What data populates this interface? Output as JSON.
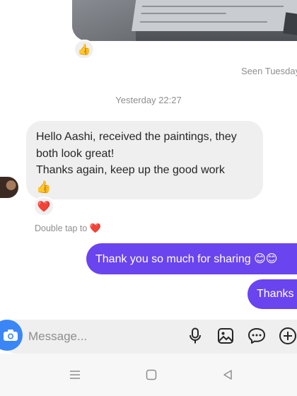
{
  "thread": {
    "photo_reaction": "👍",
    "seen_status": "Seen Tuesday",
    "timestamp": "Yesterday 22:27",
    "incoming": {
      "lines": [
        "Hello Aashi, received the paintings, they",
        "both look great!",
        "Thanks again, keep up the good work"
      ],
      "emoji": "👍",
      "reaction": "❤️"
    },
    "double_tap_hint": "Double tap to",
    "double_tap_emoji": "❤️",
    "outgoing": [
      {
        "text": "Thank you so much for sharing 😊😊"
      },
      {
        "text": "Thanks"
      }
    ]
  },
  "composer": {
    "placeholder": "Message..."
  },
  "icons": {
    "camera": "camera-icon",
    "mic": "microphone-icon",
    "gallery": "gallery-icon",
    "sticker": "sticker-icon",
    "more": "plus-circle-icon",
    "nav_menu": "recents-icon",
    "nav_home": "home-icon",
    "nav_back": "back-icon"
  },
  "colors": {
    "outgoing_bubble": "#6a44ee",
    "incoming_bubble": "#efefef",
    "camera_button": "#3a86f7"
  }
}
